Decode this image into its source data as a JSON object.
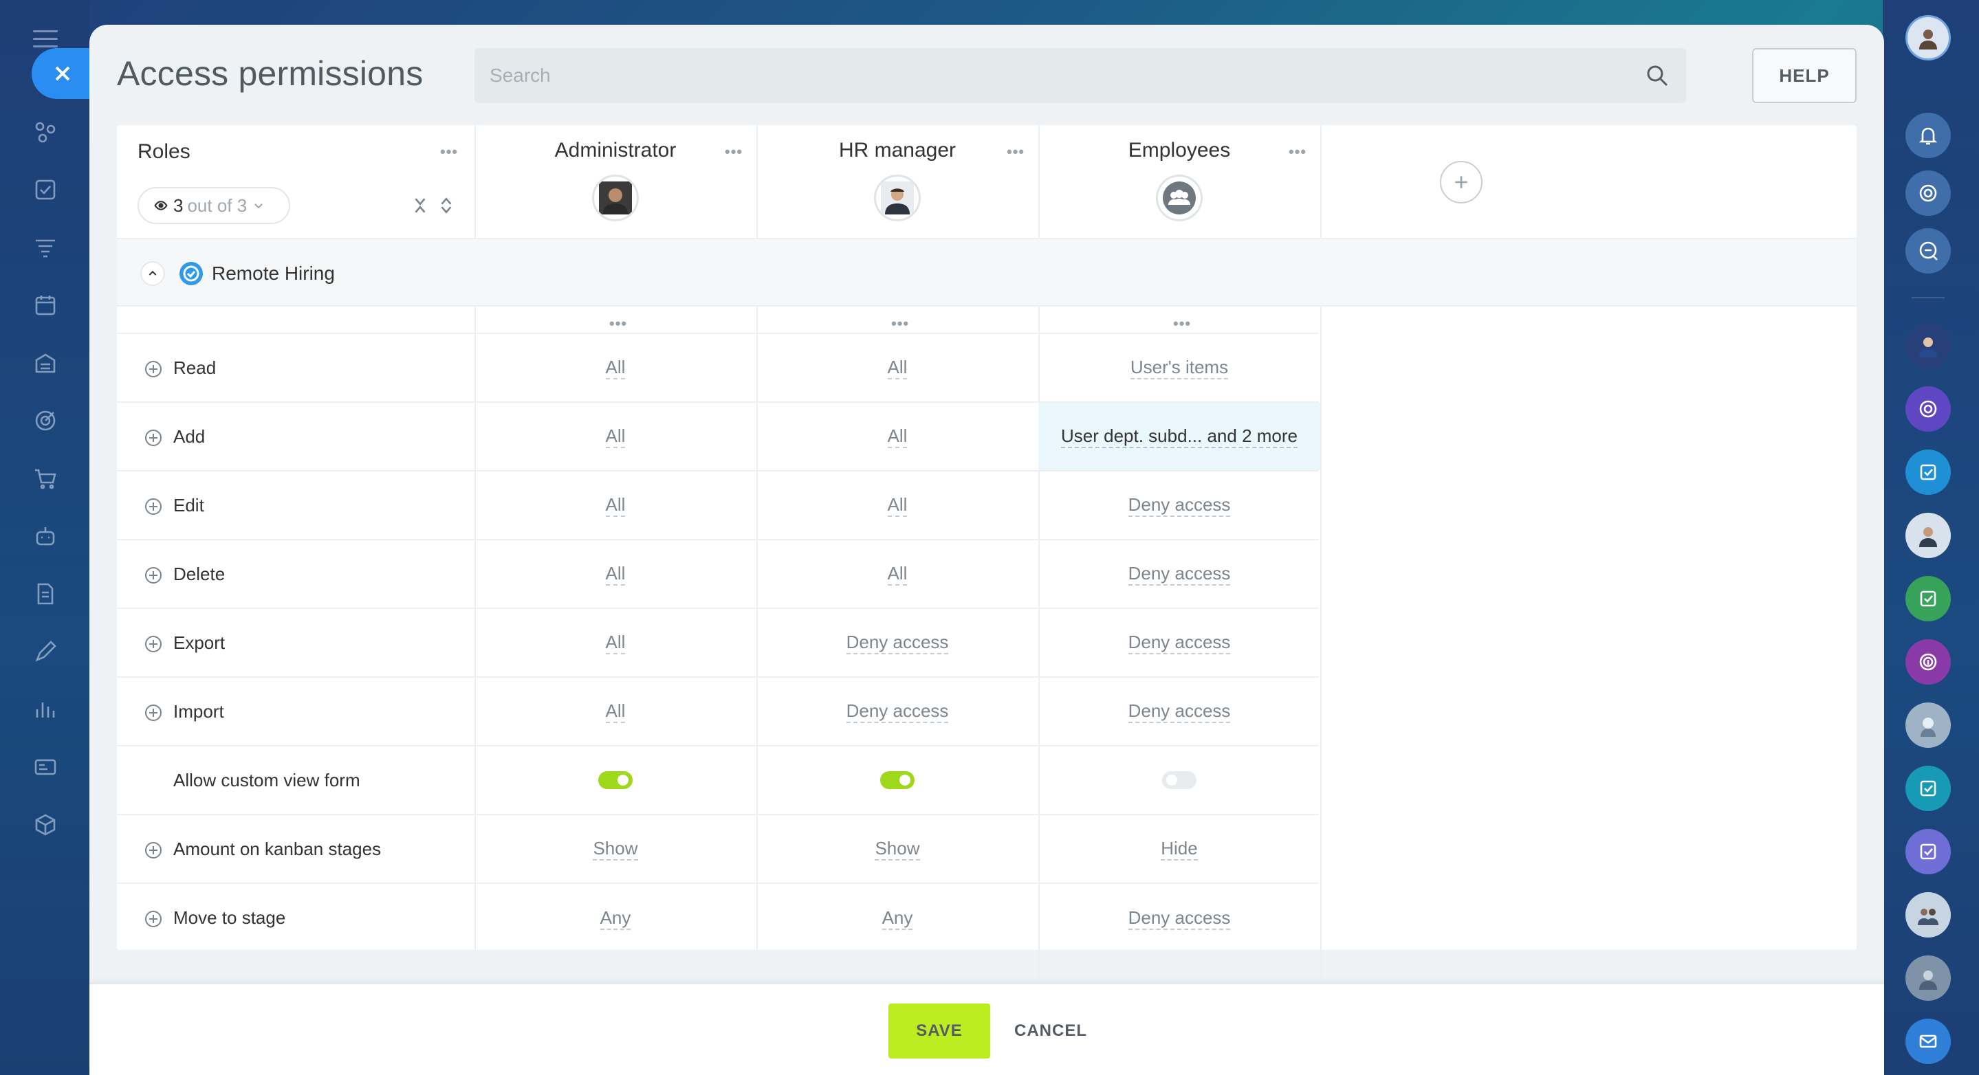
{
  "header": {
    "title": "Access permissions",
    "search_placeholder": "Search",
    "help_label": "HELP"
  },
  "roles_column": {
    "title": "Roles",
    "filter_count": "3",
    "filter_rest": "out of 3"
  },
  "columns": [
    {
      "name": "Administrator"
    },
    {
      "name": "HR manager"
    },
    {
      "name": "Employees"
    }
  ],
  "section": {
    "title": "Remote Hiring"
  },
  "rows": [
    {
      "label": "Read",
      "values": [
        "All",
        "All",
        "User's items"
      ]
    },
    {
      "label": "Add",
      "values": [
        "All",
        "All",
        "User dept. subd... and 2 more"
      ]
    },
    {
      "label": "Edit",
      "values": [
        "All",
        "All",
        "Deny access"
      ]
    },
    {
      "label": "Delete",
      "values": [
        "All",
        "All",
        "Deny access"
      ]
    },
    {
      "label": "Export",
      "values": [
        "All",
        "Deny access",
        "Deny access"
      ]
    },
    {
      "label": "Import",
      "values": [
        "All",
        "Deny access",
        "Deny access"
      ]
    },
    {
      "label": "Allow custom view form",
      "toggles": [
        true,
        true,
        false
      ]
    },
    {
      "label": "Amount on kanban stages",
      "values": [
        "Show",
        "Show",
        "Hide"
      ]
    },
    {
      "label": "Move to stage",
      "values": [
        "Any",
        "Any",
        "Deny access"
      ]
    }
  ],
  "footer": {
    "save_label": "SAVE",
    "cancel_label": "CANCEL"
  },
  "colors": {
    "accent_green": "#bbed21",
    "toggle_on": "#9dd81a",
    "close_blue": "#2a8df2"
  }
}
